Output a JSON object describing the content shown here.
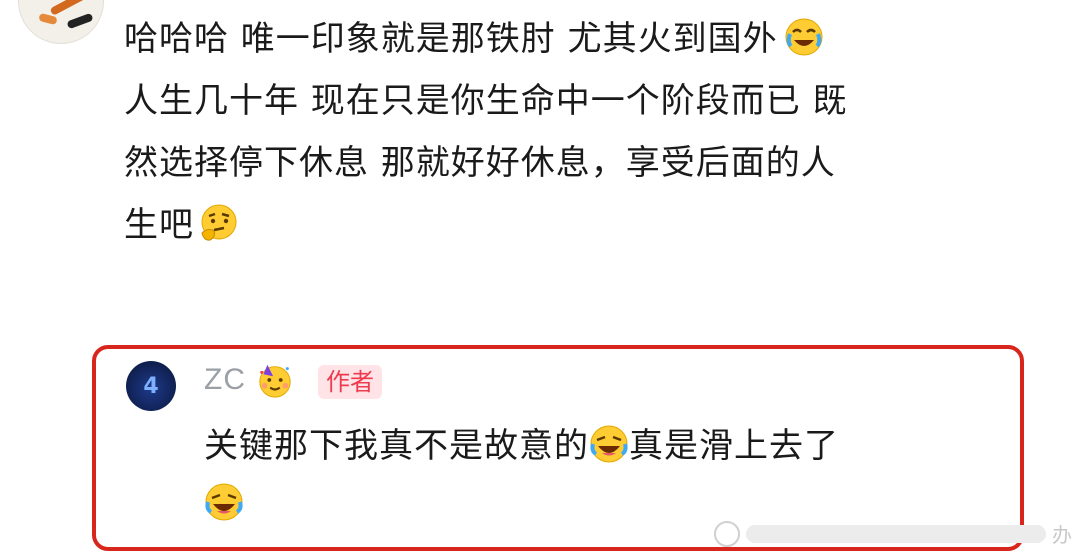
{
  "comment": {
    "lines": [
      "哈哈哈 唯一印象就是那铁肘 尤其火到国外",
      "人生几十年 现在只是你生命中一个阶段而已 既",
      "然选择停下休息 那就好好休息，享受后面的人",
      "生吧"
    ],
    "emojis": [
      "crying-laughing-emoji",
      "thinking-emoji"
    ]
  },
  "reply": {
    "avatar_text": "4",
    "username": "ZC",
    "badge": "作者",
    "line1": "关键那下我真不是故意的",
    "line1_tail": "真是滑上去了",
    "emojis": [
      "party-face-emoji",
      "rolling-laughing-emoji",
      "rolling-laughing-emoji"
    ],
    "border_color": "#d9261c"
  },
  "watermark": {
    "text": "办"
  }
}
